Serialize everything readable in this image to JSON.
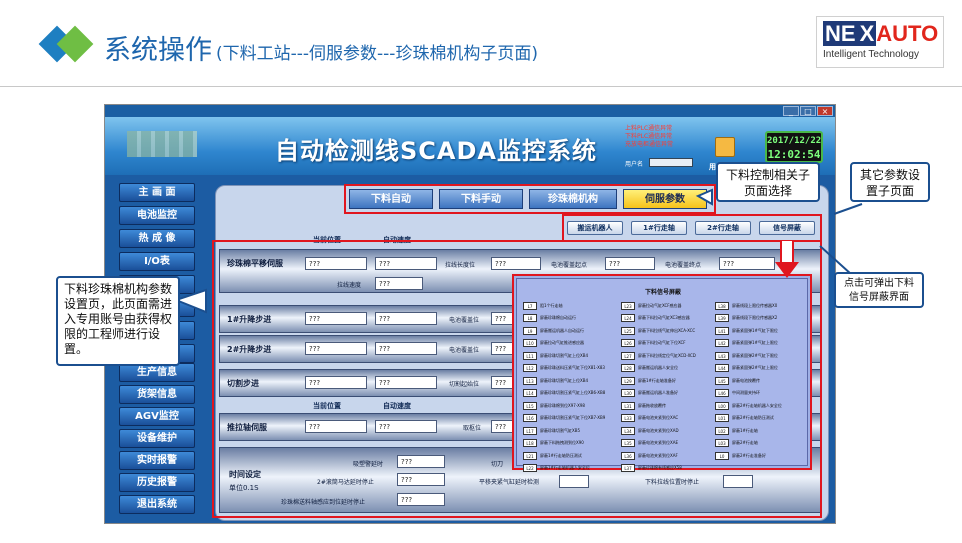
{
  "slide": {
    "title": "系统操作",
    "subtitle": "(下料工站---伺服参数---珍珠棉机构子页面)",
    "brand_ne": "NE",
    "brand_x": "X",
    "brand_auto": "AUTO",
    "brand_tagline": "Intelligent Technology"
  },
  "scada": {
    "title": "自动检测线SCADA监控系统",
    "plc_status": [
      "上料PLC通信异常",
      "下料PLC通信异常",
      "充放电柜通信异常"
    ],
    "status_label": "用户名",
    "user_label": "用户",
    "clock_date": "2017/12/22",
    "clock_time": "12:02:54",
    "window_buttons": [
      "_",
      "□",
      "×"
    ],
    "nav": [
      "主 画 面",
      "电池监控",
      "热 成 像",
      "I/O表",
      "",
      "",
      "",
      "",
      "生产信息",
      "货架信息",
      "AGV监控",
      "设备维护",
      "实时报警",
      "历史报警",
      "退出系统"
    ],
    "top_tabs": [
      "下料自动",
      "下料手动",
      "珍珠棉机构",
      "伺服参数"
    ],
    "sub_tabs": [
      "搬运机器人",
      "1#行走轴",
      "2#行走轴",
      "信号屏蔽"
    ],
    "col_current_pos": "当前位置",
    "col_auto_speed": "自动速度",
    "rows": [
      {
        "label": "珍珠棉平移伺服",
        "f1": "???",
        "f2": "???",
        "l3": "拉线长度位",
        "f3": "???",
        "l4": "电池覆盖起点",
        "f4": "???",
        "l5": "电池覆盖终点",
        "f5": "???",
        "l6": "拉线速度",
        "f6": "???"
      },
      {
        "label": "1#升降步进",
        "f1": "???",
        "f2": "???",
        "l3": "电池覆盖位",
        "f3": "???"
      },
      {
        "label": "2#升降步进",
        "f1": "???",
        "f2": "???",
        "l3": "电池覆盖位",
        "f3": "???"
      },
      {
        "label": "切割步进",
        "f1": "???",
        "f2": "???",
        "l3": "切割起始位",
        "f3": "???"
      },
      {
        "label": "推拉轴伺服",
        "f1": "???",
        "f2": "???",
        "l3": "取枢位",
        "f3": "???"
      }
    ],
    "time_setting": {
      "label": "时间设定",
      "unit": "单位0.1S",
      "items": [
        {
          "label": "吸塑警延时",
          "value": "???"
        },
        {
          "label": "2#滚筒马达延时停止",
          "value": "???"
        },
        {
          "label": "珍珠棉送料轴感应到位延时停止",
          "value": "???"
        }
      ],
      "extra_label_1": "切刀",
      "extra_label_2": "平移夹紧气缸延时检测",
      "extra_label_3": "下料拉线位置时停止"
    }
  },
  "popup": {
    "title": "下料信号屏蔽",
    "signals": [
      [
        "L7",
        "阻1个行走轴"
      ],
      [
        "L23",
        "屏蔽拉动气缸XCF感应器"
      ],
      [
        "L38",
        "屏蔽线段上限位传感器X0"
      ],
      [
        "L8",
        "屏蔽珍珠棉自动运行"
      ],
      [
        "L24",
        "屏蔽下料拉动气缸XC3感应器"
      ],
      [
        "L39",
        "屏蔽线段下限位传感器X2"
      ],
      [
        "L9",
        "屏蔽搬运机器人自动运行"
      ],
      [
        "L25",
        "屏蔽下料拉线气缸伸出XCA-XCC"
      ],
      [
        "L41",
        "屏蔽紧固弹1#气缸下限位"
      ],
      [
        "L10",
        "屏蔽拉动气缸推进感应器"
      ],
      [
        "L26",
        "屏蔽下料拉动气缸下位XCF"
      ],
      [
        "L42",
        "屏蔽紧固弹1#气缸上限位"
      ],
      [
        "L11",
        "屏蔽珍珠切割气缸上位XB4"
      ],
      [
        "L27",
        "屏蔽下料拉线定位气缸XCD-XCD"
      ],
      [
        "L43",
        "屏蔽紧固弹2#气缸下限位"
      ],
      [
        "L12",
        "屏蔽珍珠送料压紧气缸下位X81-X83"
      ],
      [
        "L28",
        "屏蔽搬运机器人安全位"
      ],
      [
        "L44",
        "屏蔽紧固弹2#气缸上限位"
      ],
      [
        "L13",
        "屏蔽珍珠切割气缸上位XB4"
      ],
      [
        "L29",
        "屏蔽1#行走轴准备好"
      ],
      [
        "L45",
        "屏蔽电池按覆传"
      ],
      [
        "L14",
        "屏蔽珍珠切割压紧气缸上位XB6-XB8"
      ],
      [
        "L30",
        "屏蔽搬运机器人准备好"
      ],
      [
        "L46",
        "中间测量夹持环"
      ],
      [
        "L15",
        "屏蔽珍珠棉到位X97-X98"
      ],
      [
        "L31",
        "屏蔽拖收放覆传"
      ],
      [
        "L00",
        "屏蔽2#行走轴机器人安全位"
      ],
      [
        "L16",
        "屏蔽珍珠切割压紧气缸下位XB7-XB9"
      ],
      [
        "L33",
        "屏蔽电池夹紧到位XAC"
      ],
      [
        "L01",
        "屏蔽2#行走轴防压测试"
      ],
      [
        "L17",
        "屏蔽珍珠切割气缸XB5"
      ],
      [
        "L34",
        "屏蔽电池夹紧到位XAD"
      ],
      [
        "L02",
        "屏蔽1#行走轴"
      ],
      [
        "L18",
        "屏蔽下料拖拽测到位X90"
      ],
      [
        "L35",
        "屏蔽电池夹紧到位XAE"
      ],
      [
        "L03",
        "屏蔽2#行走轴"
      ],
      [
        "L21",
        "屏蔽1#行走轴防压测试"
      ],
      [
        "L36",
        "屏蔽电池夹紧到位XAF"
      ],
      [
        "L0",
        "屏蔽2#行走准备好"
      ],
      [
        "L22",
        "屏蔽1#行走轴机器人安全位"
      ],
      [
        "L37",
        "屏蔽珍珠棉有线感应X58"
      ],
      [
        "",
        ""
      ]
    ]
  },
  "callouts": {
    "left": "下料珍珠棉机构参数设置页，此页面需进入专用账号由获得权限的工程师进行设置。",
    "sub_page": "下料控制相关子页面选择",
    "other_params": "其它参数设置子页面",
    "popup_hint": "点击可弹出下料信号屏蔽界面"
  },
  "colors": {
    "accent_red": "#e0161f",
    "title_blue": "#1e66ad",
    "callout_border": "#1b4f8f",
    "active_tab": "#f6c21a"
  }
}
